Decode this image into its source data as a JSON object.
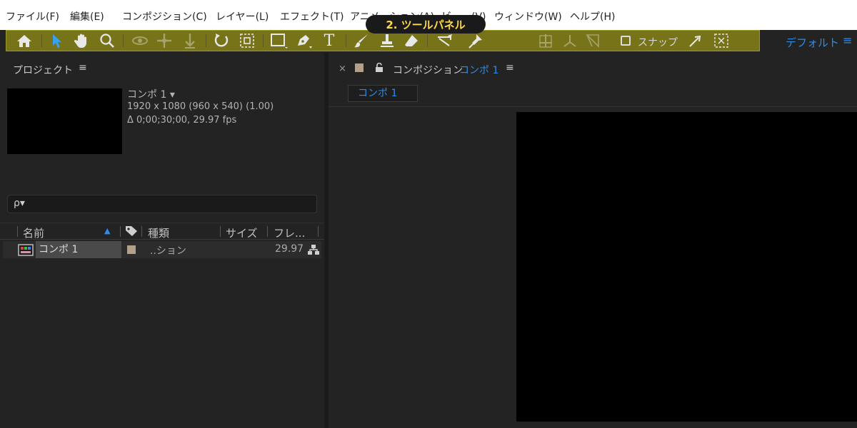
{
  "menu": [
    "ファイル(F)",
    "編集(E)",
    "コンポジション(C)",
    "レイヤー(L)",
    "エフェクト(T)",
    "アニメーション(A)",
    "ビュー(V)",
    "ウィンドウ(W)",
    "ヘルプ(H)"
  ],
  "tooltip": "2. ツールパネル",
  "toolbar": {
    "snap_label": "スナップ",
    "workspace": "デフォルト",
    "menu_glyph": "≡",
    "text_tool_glyph": "T"
  },
  "project": {
    "title": "プロジェクト",
    "menu_glyph": "≡",
    "comp_name": "コンポ 1",
    "dims": "1920 x 1080  (960 x 540) (1.00)",
    "duration": "Δ 0;00;30;00, 29.97 fps",
    "search_glyph": "ρ▾",
    "columns": {
      "name": "名前",
      "type": "種類",
      "size": "サイズ",
      "frame": "フレ..."
    },
    "rows": [
      {
        "name": "コンポ 1",
        "type": "..ション",
        "fps": "29.97"
      }
    ]
  },
  "comp": {
    "close": "×",
    "title": "コンポジション",
    "name": "コンポ 1",
    "menu_glyph": "≡",
    "tab_label": "コンポ 1"
  },
  "colors": {
    "toolbar_highlight": "#767318",
    "accent": "#2d8ceb",
    "tooltip_text": "#ffd84a",
    "label": "#b3a08a"
  }
}
